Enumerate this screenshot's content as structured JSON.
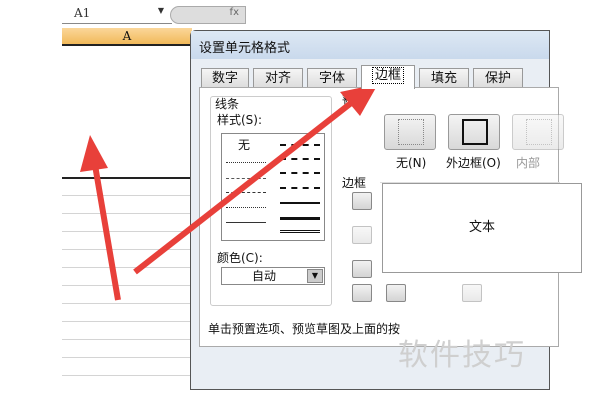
{
  "sheet": {
    "name_box": "A1",
    "fx_label": "fx",
    "column_header": "A"
  },
  "dialog": {
    "title": "设置单元格格式",
    "tabs": [
      {
        "label": "数字"
      },
      {
        "label": "对齐"
      },
      {
        "label": "字体"
      },
      {
        "label": "边框",
        "active": true
      },
      {
        "label": "填充"
      },
      {
        "label": "保护"
      }
    ],
    "line_group": {
      "title": "线条",
      "style_label": "样式(S):",
      "none_label": "无",
      "color_label": "颜色(C):",
      "color_value": "自动"
    },
    "presets": {
      "title": "预置",
      "buttons": [
        {
          "label": "无(N)"
        },
        {
          "label": "外边框(O)"
        },
        {
          "label": "内部"
        }
      ]
    },
    "border": {
      "title": "边框",
      "preview_text": "文本"
    },
    "hint": "单击预置选项、预览草图及上面的按"
  },
  "watermark": "软件技巧",
  "colors": {
    "arrow": "#e8403a",
    "header": "#f1b95a",
    "title_bar": "#c9d9ec"
  }
}
